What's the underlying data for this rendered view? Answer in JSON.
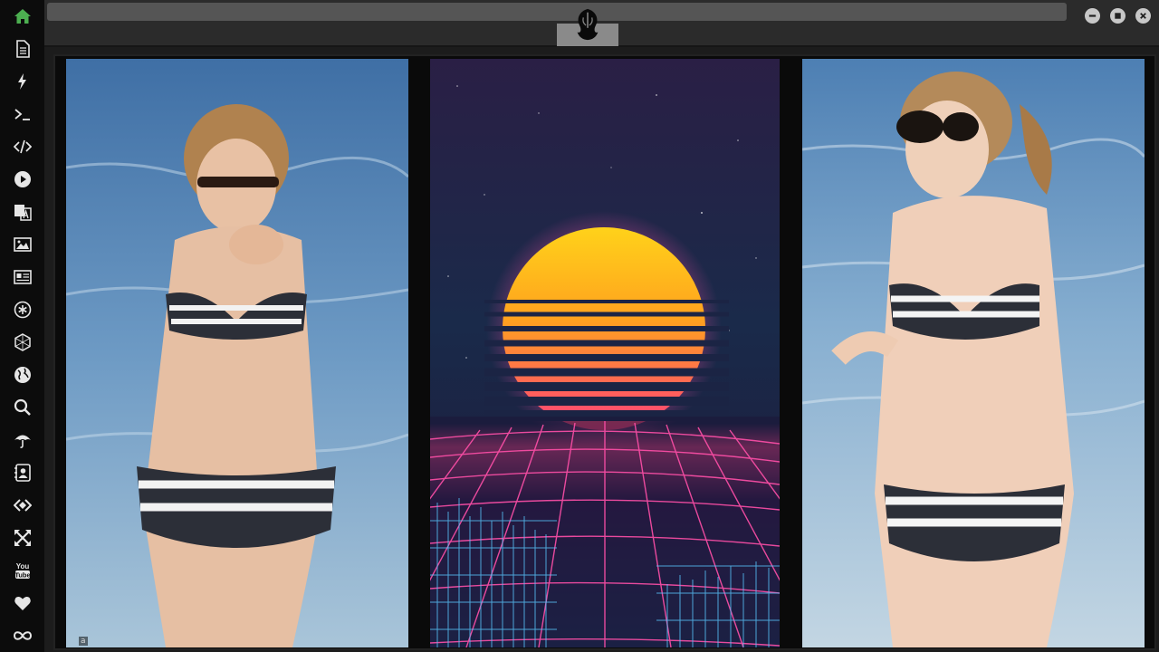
{
  "sidebar": {
    "items": [
      {
        "icon": "home-icon",
        "color": "#4caf50"
      },
      {
        "icon": "document-icon"
      },
      {
        "icon": "lightning-icon"
      },
      {
        "icon": "terminal-icon"
      },
      {
        "icon": "code-icon"
      },
      {
        "icon": "play-icon"
      },
      {
        "icon": "translate-icon"
      },
      {
        "icon": "image-icon"
      },
      {
        "icon": "newspaper-icon"
      },
      {
        "icon": "asterisk-icon"
      },
      {
        "icon": "hexagon-icon"
      },
      {
        "icon": "globe-icon"
      },
      {
        "icon": "search-icon"
      },
      {
        "icon": "umbrella-icon"
      },
      {
        "icon": "contact-icon"
      },
      {
        "icon": "code-diamond-icon"
      },
      {
        "icon": "expand-icon"
      },
      {
        "icon": "youtube-icon"
      },
      {
        "icon": "heart-icon"
      },
      {
        "icon": "infinity-icon"
      }
    ],
    "youtube_label": "You Tube"
  },
  "header": {
    "logo": "rebel-alliance-logo-icon",
    "window_controls": [
      "minimize-icon",
      "maximize-icon",
      "close-icon"
    ]
  },
  "gallery": {
    "images": [
      {
        "name": "beach-photo-left",
        "description_icon": "photo"
      },
      {
        "name": "synthwave-sunset",
        "description_icon": "photo"
      },
      {
        "name": "beach-photo-right",
        "description_icon": "photo"
      }
    ],
    "caption": "a"
  },
  "colors": {
    "accent_home": "#4caf50",
    "icon": "#e6e6e6",
    "sun_top": "#ffd21a",
    "sun_bottom": "#ff3f7a",
    "grid": "#ff4fa8",
    "sky": "#1b1f3d"
  }
}
